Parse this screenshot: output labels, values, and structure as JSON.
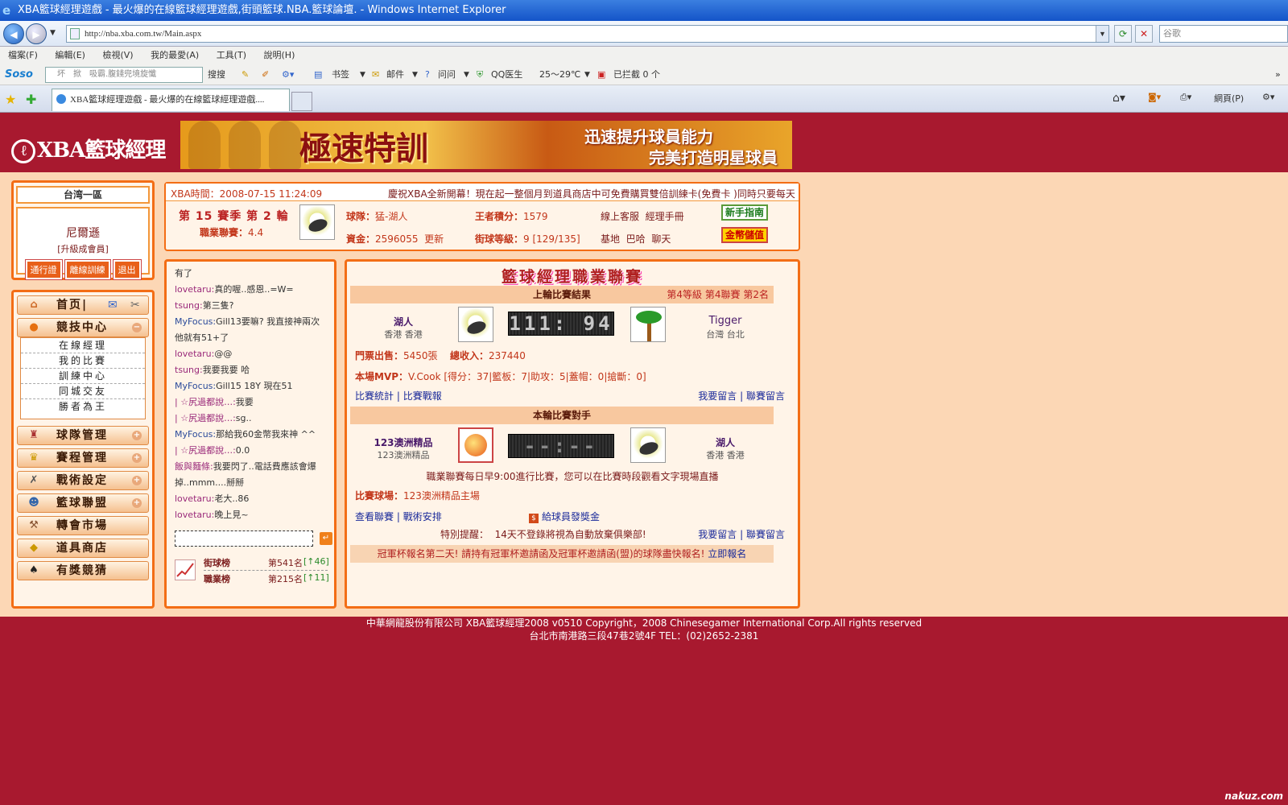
{
  "browser": {
    "title": "XBA籃球經理遊戲 - 最火爆的在線籃球經理遊戲,街頭籃球.NBA.籃球論壇. - Windows Internet Explorer",
    "url": "http://nba.xba.com.tw/Main.aspx",
    "search_placeholder": "谷歌",
    "menu": [
      "檔案(F)",
      "編輯(E)",
      "檢視(V)",
      "我的最愛(A)",
      "工具(T)",
      "說明(H)"
    ],
    "soso_label": "Soso",
    "soso_text": "坏　掀　吸霸.腹錢兜境旋懺",
    "toolbar": {
      "search": "搜搜",
      "bookmark": "书签",
      "mail": "邮件",
      "ask": "问问",
      "qq_doctor": "QQ医生",
      "weather": "25～29℃",
      "blocked": "已拦截 0 个"
    },
    "tab_title": "XBA籃球經理遊戲 - 最火爆的在線籃球經理遊戲....",
    "right_tools": {
      "page": "網頁(P)"
    }
  },
  "site": {
    "logo": "XBA籃球經理",
    "banner": {
      "title": "極速特訓",
      "line1": "迅速提升球員能力",
      "line2": "完美打造明星球員"
    }
  },
  "user": {
    "server": "台湾一區",
    "name": "尼爾遜",
    "level": "[升級成會員]",
    "buttons": [
      "通行證",
      "離線訓練",
      "退出"
    ]
  },
  "nav": {
    "home": "首页|",
    "arena": "競技中心",
    "arena_sub": [
      "在線經理",
      "我的比賽",
      "訓練中心",
      "同城交友",
      "勝者為王"
    ],
    "team": "球隊管理",
    "schedule": "賽程管理",
    "tactics": "戰術設定",
    "league": "籃球聯盟",
    "transfer": "轉會市場",
    "shop": "道具商店",
    "lottery": "有獎競猜"
  },
  "info": {
    "time_label": "XBA時間：",
    "time": "2008-07-15 11:24:09",
    "marquee": "慶祝XBA全新開幕！現在起一整個月到道具商店中可免費購買雙倍訓練卡(免費卡 )同時只要每天",
    "season": "第 15 賽季 第 2 輪",
    "pro_label": "職業聯賽：",
    "pro_value": "4.4",
    "team_label": "球隊：",
    "team_value": "猛-湖人",
    "king_label": "王者積分：",
    "king_value": "1579",
    "online": "線上客服",
    "manual": "經理手冊",
    "fund_label": "資金：",
    "fund_value": "2596055",
    "update": "更新",
    "street_label": "街球等級：",
    "street_value": "9 [129/135]",
    "base": "基地",
    "bar": "巴哈",
    "chat": "聊天",
    "newbie_btn": "新手指南",
    "gold_btn": "金幣儲值"
  },
  "chat": {
    "messages": [
      {
        "name": "",
        "text": "有了"
      },
      {
        "name": "lovetaru:",
        "text": "真的喔..感恩..=W="
      },
      {
        "name": "tsung:",
        "text": "第三隻?"
      },
      {
        "name": "MyFocus:",
        "text": "Gill13要嘛? 我直接神兩次"
      },
      {
        "name": "",
        "text": "他就有51+了"
      },
      {
        "name": "lovetaru:",
        "text": "@@"
      },
      {
        "name": "tsung:",
        "text": "我要我要 哈"
      },
      {
        "name": "MyFocus:",
        "text": "Gill15 18Y 現在51"
      },
      {
        "name": "| ☆尻過都說…:",
        "text": "我要"
      },
      {
        "name": "| ☆尻過都說…:",
        "text": "sg.."
      },
      {
        "name": "MyFocus:",
        "text": "那給我60金幣我來神 ^^"
      },
      {
        "name": "| ☆尻過都說…:",
        "text": "0.0"
      },
      {
        "name": "飯與麵條:",
        "text": "我要閃了..電話費應該會爆"
      },
      {
        "name": "",
        "text": "掉..mmm....掰掰"
      },
      {
        "name": "lovetaru:",
        "text": "老大..86"
      },
      {
        "name": "lovetaru:",
        "text": "晚上見~"
      }
    ],
    "rank": [
      {
        "label": "街球榜",
        "value": "第541名",
        "change": "[↑46]"
      },
      {
        "label": "職業榜",
        "value": "第215名",
        "change": "[↑11]"
      }
    ]
  },
  "league": {
    "title": "籃球經理職業聯賽",
    "last_result": "上輪比賽結果",
    "last_level": "第4等級",
    "last_league": "第4聯賽",
    "last_rank": "第2名",
    "home_team": "湖人",
    "home_loc": "香港 香港",
    "score": "111: 94",
    "away_team": "Tigger",
    "away_loc": "台灣 台北",
    "ticket_label": "門票出售：",
    "ticket_value": "5450張",
    "income_label": "總收入：",
    "income_value": "237440",
    "mvp_label": "本場MVP：",
    "mvp_value": "V.Cook [得分：37|籃板：7|助攻：5|蓋帽：0|搶斷：0]",
    "stats_link": "比賽統計",
    "report_link": "比賽戰報",
    "msg_link": "我要留言",
    "league_msg_link": "聯賽留言",
    "next_opponent": "本輪比賽對手",
    "opp_team": "123澳洲精品",
    "opp_sub": "123澳洲精品",
    "next_score": "--:--",
    "my_team": "湖人",
    "my_loc": "香港 香港",
    "schedule_note": "職業聯賽每日早9:00進行比賽，您可以在比賽時段觀看文字現場直播",
    "venue_label": "比賽球場：",
    "venue_value": "123澳洲精品主場",
    "view_league": "查看聯賽",
    "tactics_link": "戰術安排",
    "bonus_link": "給球員發獎金",
    "reminder_label": "特別提醒：",
    "reminder_text": "14天不登錄將視為自動放棄俱樂部!",
    "msg_link2": "我要留言",
    "league_msg_link2": "聯賽留言",
    "cup_notice": "冠軍杯報名第二天! 請持有冠軍杯邀請函及冠軍杯邀請函(盟)的球隊盡快報名! ",
    "cup_link": "立即報名"
  },
  "footer": {
    "line1": "中華網龍股份有限公司  XBA籃球經理2008 v0510     Copyright，2008 Chinesegamer International Corp.All rights reserved",
    "line2": "台北市南港路三段47巷2號4F TEL：(02)2652-2381"
  },
  "watermark": "nakuz.com"
}
